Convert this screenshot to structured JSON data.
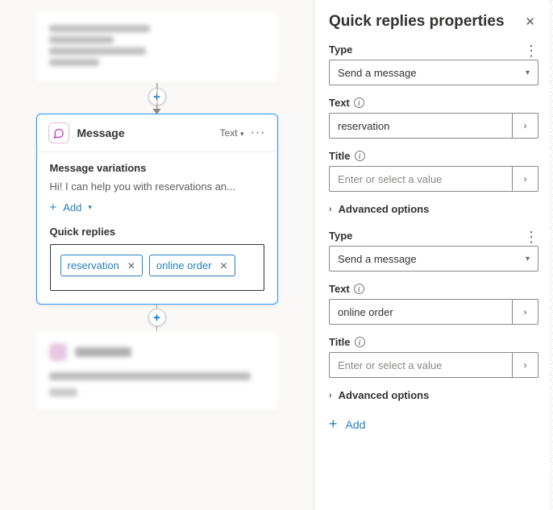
{
  "canvas": {
    "message_card": {
      "title": "Message",
      "mode_label": "Text",
      "variations_label": "Message variations",
      "variation_preview": "Hi! I can help you with reservations an...",
      "add_label": "Add",
      "quick_replies_label": "Quick replies",
      "chips": [
        "reservation",
        "online order"
      ]
    }
  },
  "panel": {
    "title": "Quick replies properties",
    "replies": [
      {
        "type_label": "Type",
        "type_value": "Send a message",
        "text_label": "Text",
        "text_value": "reservation",
        "title_label": "Title",
        "title_placeholder": "Enter or select a value",
        "advanced_label": "Advanced options"
      },
      {
        "type_label": "Type",
        "type_value": "Send a message",
        "text_label": "Text",
        "text_value": "online order",
        "title_label": "Title",
        "title_placeholder": "Enter or select a value",
        "advanced_label": "Advanced options"
      }
    ],
    "add_label": "Add"
  }
}
